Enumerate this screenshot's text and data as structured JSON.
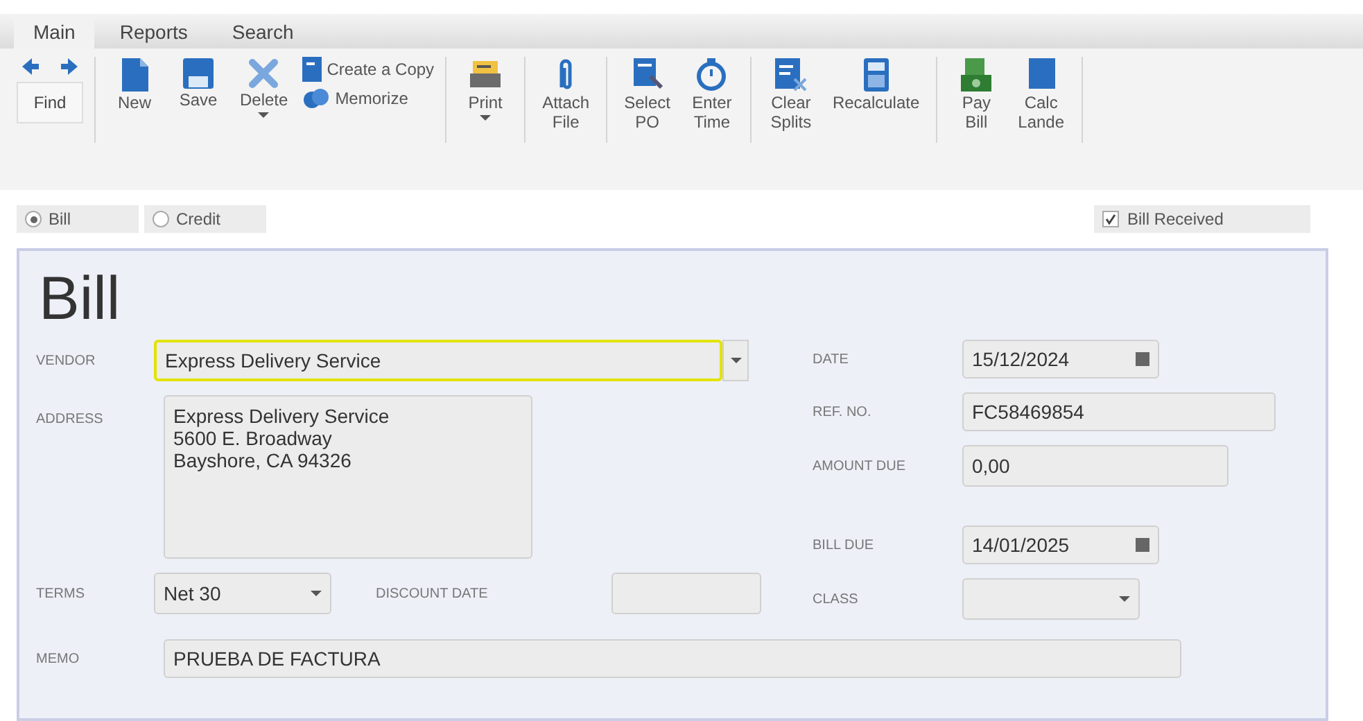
{
  "tabs": [
    {
      "label": "Main",
      "selected": true
    },
    {
      "label": "Reports",
      "selected": false
    },
    {
      "label": "Search",
      "selected": false
    }
  ],
  "toolbar": {
    "find": "Find",
    "groups": [
      [
        {
          "kind": "large",
          "lines": [
            "New"
          ],
          "caret": false
        },
        {
          "kind": "large",
          "lines": [
            "Save"
          ],
          "caret": false
        },
        {
          "kind": "large",
          "lines": [
            "Delete"
          ],
          "caret": true
        },
        {
          "kind": "stack",
          "items": [
            "Create a Copy",
            "Memorize"
          ]
        }
      ],
      [
        {
          "kind": "large",
          "lines": [
            "Print"
          ],
          "caret": true
        }
      ],
      [
        {
          "kind": "large",
          "lines": [
            "Attach",
            "File"
          ],
          "caret": false
        }
      ],
      [
        {
          "kind": "large",
          "lines": [
            "Select",
            "PO"
          ],
          "caret": false
        },
        {
          "kind": "large",
          "lines": [
            "Enter",
            "Time"
          ],
          "caret": false
        }
      ],
      [
        {
          "kind": "large",
          "lines": [
            "Clear",
            "Splits"
          ],
          "caret": false
        },
        {
          "kind": "large",
          "lines": [
            "Recalculate"
          ],
          "caret": false
        }
      ],
      [
        {
          "kind": "large",
          "lines": [
            "Pay",
            "Bill"
          ],
          "caret": false
        },
        {
          "kind": "large",
          "lines": [
            "Calc",
            "Lande"
          ],
          "caret": false
        }
      ]
    ]
  },
  "type_options": [
    {
      "label": "Bill",
      "selected": true
    },
    {
      "label": "Credit",
      "selected": false
    }
  ],
  "bill_received": {
    "label": "Bill Received",
    "checked": true
  },
  "form": {
    "title": "Bill",
    "vendor": {
      "label": "VENDOR",
      "value": "Express Delivery Service"
    },
    "address": {
      "label": "ADDRESS",
      "lines": [
        "Express Delivery Service",
        "5600 E. Broadway",
        "Bayshore, CA 94326"
      ]
    },
    "terms": {
      "label": "TERMS",
      "value": "Net 30"
    },
    "discount_date": {
      "label": "DISCOUNT DATE"
    },
    "date": {
      "label": "DATE",
      "value": "15/12/2024"
    },
    "ref_no": {
      "label": "REF. NO.",
      "value": "FC58469854"
    },
    "amount_due": {
      "label": "AMOUNT DUE",
      "value": "0,00"
    },
    "bill_due": {
      "label": "BILL DUE",
      "value": "14/01/2025"
    },
    "class": {
      "label": "CLASS"
    },
    "memo": {
      "label": "MEMO",
      "value": "PRUEBA DE FACTURA"
    }
  }
}
